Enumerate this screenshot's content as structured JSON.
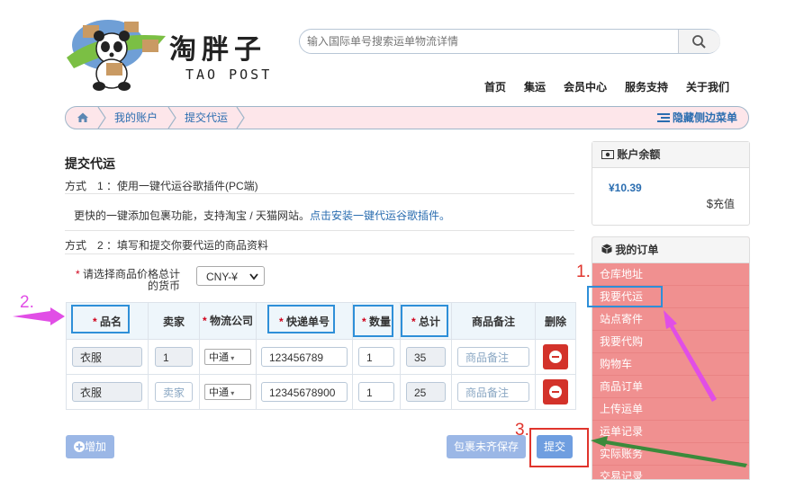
{
  "header": {
    "logo_title": "淘胖子",
    "logo_sub": "TAO POST",
    "search_placeholder": "输入国际单号搜索运单物流详情",
    "nav": [
      "首页",
      "集运",
      "会员中心",
      "服务支持",
      "关于我们"
    ]
  },
  "breadcrumb": {
    "items": [
      "我的账户",
      "提交代运"
    ],
    "hide_sidebar": "隐藏侧边菜单"
  },
  "main": {
    "title": "提交代运",
    "method1": "方式　1 ：使用一键代运谷歌插件(PC端)",
    "method1_desc": "更快的一键添加包裹功能，支持淘宝 / 天猫网站。",
    "method1_link": "点击安装一键代运谷歌插件。",
    "method2": "方式　2 ：填写和提交你要代运的商品资料",
    "currency_label_1": "请选择商品价格总计",
    "currency_label_2": "的货币",
    "currency_value": "CNY-¥"
  },
  "table": {
    "headers": [
      "品名",
      "卖家",
      "物流公司",
      "快递单号",
      "数量",
      "总计",
      "商品备注",
      "删除"
    ],
    "rows": [
      {
        "name": "衣服",
        "seller": "1",
        "carrier": "中通",
        "tracking": "123456789",
        "qty": "1",
        "total": "35",
        "note_placeholder": "商品备注"
      },
      {
        "name": "衣服",
        "seller": "卖家",
        "carrier": "中通",
        "tracking": "12345678900",
        "qty": "1",
        "total": "25",
        "note_placeholder": "商品备注"
      }
    ]
  },
  "buttons": {
    "add": "增加",
    "save_incomplete": "包裹未齐保存",
    "submit": "提交"
  },
  "sidebar": {
    "balance_title": "账户余额",
    "balance_amount": "¥10.39",
    "recharge": "充值",
    "orders_title": "我的订单",
    "items": [
      "仓库地址",
      "我要代运",
      "站点寄件",
      "我要代购",
      "购物车",
      "商品订单",
      "上传运单",
      "运单记录",
      "实际账务",
      "交易记录"
    ]
  },
  "annotations": {
    "n1": "1.",
    "n2": "2.",
    "n3": "3."
  },
  "colors": {
    "accent": "#2a6db0",
    "sidebar_menu_bg": "#f09090",
    "required": "#d0021b",
    "annotation_blue": "#2e8fd8",
    "annotation_red": "#e0342c",
    "annotation_magenta": "#e14ee6",
    "annotation_green": "#3b8a3b"
  }
}
